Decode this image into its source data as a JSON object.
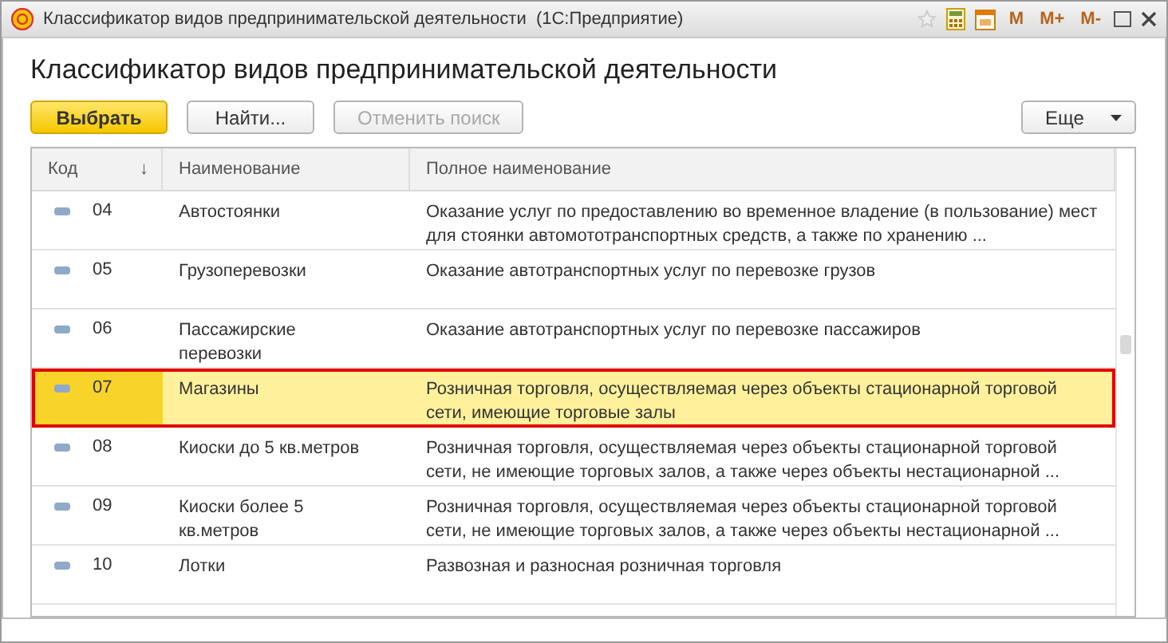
{
  "window": {
    "title": "Классификатор видов предпринимательской деятельности  (1С:Предприятие)",
    "memory_buttons": [
      "M",
      "M+",
      "M-"
    ]
  },
  "form_title": "Классификатор видов предпринимательской деятельности",
  "toolbar": {
    "buttons": [
      {
        "label": "Выбрать",
        "kind": "primary",
        "disabled": false
      },
      {
        "label": "Найти...",
        "kind": "normal",
        "disabled": false
      },
      {
        "label": "Отменить поиск",
        "kind": "normal",
        "disabled": true
      }
    ],
    "more": {
      "label": "Еще"
    }
  },
  "table": {
    "columns": [
      {
        "label": "Код",
        "sort": "↓"
      },
      {
        "label": "Наименование"
      },
      {
        "label": "Полное наименование"
      }
    ],
    "rows": [
      {
        "code": "04",
        "name": [
          "Автостоянки"
        ],
        "full": [
          "Оказание услуг по предоставлению во временное владение (в пользование) мест",
          "для стоянки автомототранспортных средств, а также по хранению ..."
        ],
        "selected": false
      },
      {
        "code": "05",
        "name": [
          "Грузоперевозки"
        ],
        "full": [
          "Оказание автотранспортных услуг по перевозке грузов"
        ],
        "selected": false
      },
      {
        "code": "06",
        "name": [
          "Пассажирские",
          "перевозки"
        ],
        "full": [
          "Оказание автотранспортных услуг по перевозке пассажиров"
        ],
        "selected": false
      },
      {
        "code": "07",
        "name": [
          "Магазины"
        ],
        "full": [
          "Розничная торговля, осуществляемая через объекты стационарной торговой",
          "сети, имеющие торговые залы"
        ],
        "selected": true
      },
      {
        "code": "08",
        "name": [
          "Киоски до 5 кв.метров"
        ],
        "full": [
          "Розничная торговля, осуществляемая через объекты стационарной торговой",
          "сети, не имеющие торговых залов, а также через объекты нестационарной ..."
        ],
        "selected": false
      },
      {
        "code": "09",
        "name": [
          "Киоски более 5",
          "кв.метров"
        ],
        "full": [
          "Розничная торговля, осуществляемая через объекты стационарной торговой",
          "сети, не имеющие торговых залов, а также через объекты нестационарной ..."
        ],
        "selected": false
      },
      {
        "code": "10",
        "name": [
          "Лотки"
        ],
        "full": [
          "Развозная и разносная розничная торговля"
        ],
        "selected": false
      }
    ]
  }
}
